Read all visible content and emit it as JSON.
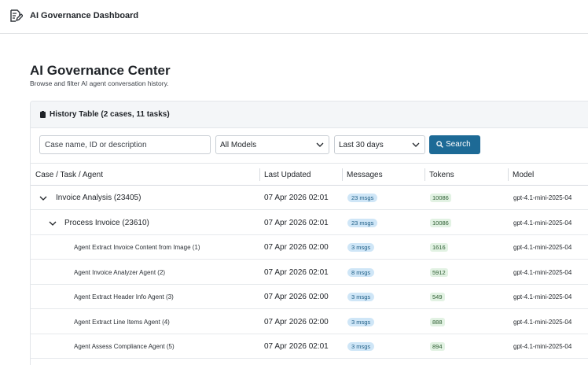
{
  "app": {
    "title": "AI Governance Dashboard",
    "icon": "document-edit-icon"
  },
  "page": {
    "title": "AI Governance Center",
    "subtitle": "Browse and filter AI agent conversation history."
  },
  "card": {
    "title": "History Table (2 cases, 11 tasks)",
    "icon": "clipboard-icon"
  },
  "filters": {
    "search_placeholder": "Case name, ID or description",
    "model_value": "All Models",
    "range_value": "Last 30 days",
    "search_label": "Search"
  },
  "columns": [
    "Case / Task / Agent",
    "Last Updated",
    "Messages",
    "Tokens",
    "Model"
  ],
  "rows": [
    {
      "level": 0,
      "expanded": true,
      "name": "Invoice Analysis (23405)",
      "updated": "07 Apr 2026 02:01",
      "messages": "23 msgs",
      "tokens": "10086",
      "model": "gpt-4.1-mini-2025-04"
    },
    {
      "level": 1,
      "expanded": true,
      "name": "Process Invoice (23610)",
      "updated": "07 Apr 2026 02:01",
      "messages": "23 msgs",
      "tokens": "10086",
      "model": "gpt-4.1-mini-2025-04"
    },
    {
      "level": 2,
      "name": "Agent Extract Invoice Content from Image (1)",
      "updated": "07 Apr 2026 02:00",
      "messages": "3 msgs",
      "tokens": "1616",
      "model": "gpt-4.1-mini-2025-04"
    },
    {
      "level": 2,
      "name": "Agent Invoice Analyzer Agent (2)",
      "updated": "07 Apr 2026 02:01",
      "messages": "8 msgs",
      "tokens": "5912",
      "model": "gpt-4.1-mini-2025-04"
    },
    {
      "level": 2,
      "name": "Agent Extract Header Info Agent (3)",
      "updated": "07 Apr 2026 02:00",
      "messages": "3 msgs",
      "tokens": "549",
      "model": "gpt-4.1-mini-2025-04"
    },
    {
      "level": 2,
      "name": "Agent Extract Line Items Agent (4)",
      "updated": "07 Apr 2026 02:00",
      "messages": "3 msgs",
      "tokens": "888",
      "model": "gpt-4.1-mini-2025-04"
    },
    {
      "level": 2,
      "name": "Agent Assess Compliance Agent (5)",
      "updated": "07 Apr 2026 02:01",
      "messages": "3 msgs",
      "tokens": "894",
      "model": "gpt-4.1-mini-2025-04"
    }
  ],
  "colors": {
    "primary": "#1d6a96",
    "msg_badge_bg": "#cfe6f7",
    "token_badge_bg": "#e2f2e3"
  }
}
